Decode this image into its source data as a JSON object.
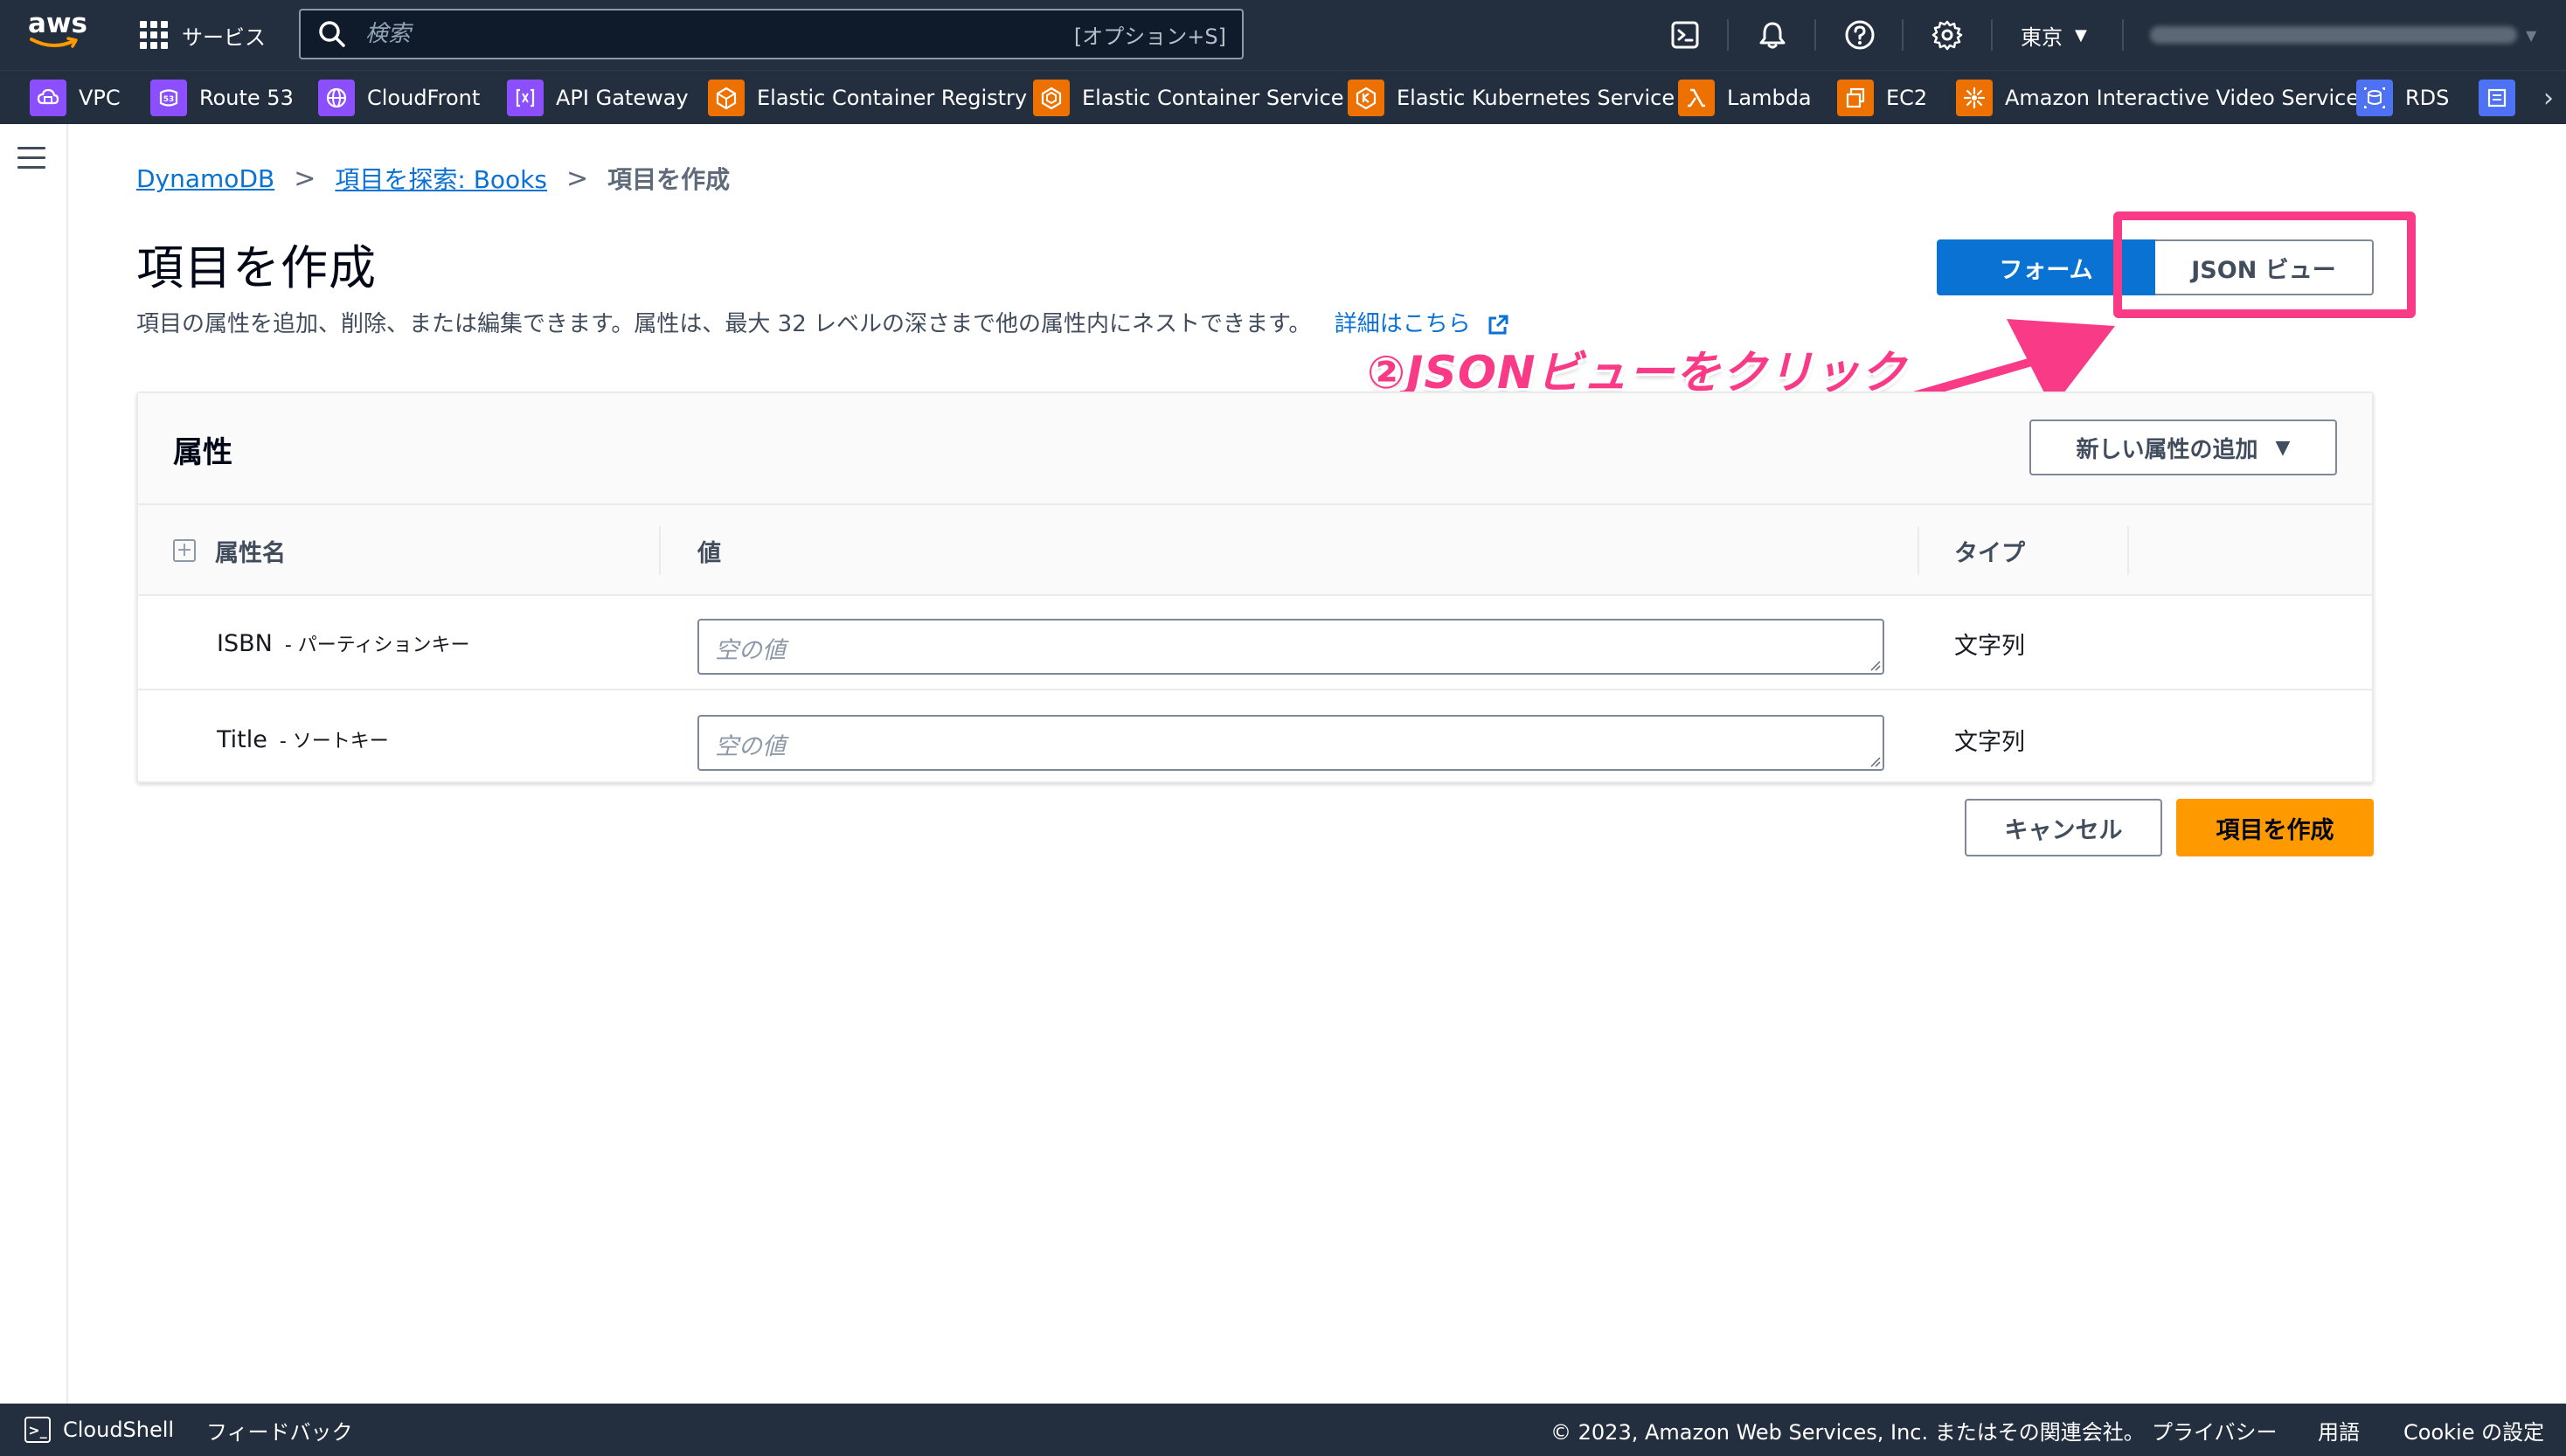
{
  "nav": {
    "logo": "aws",
    "services_label": "サービス",
    "search_placeholder": "検索",
    "search_shortcut": "[オプション+S]",
    "region": "東京"
  },
  "favorites": [
    {
      "label": "VPC",
      "icon": "vpc-icon",
      "color": "#8c4fff"
    },
    {
      "label": "Route 53",
      "icon": "route53-icon",
      "color": "#8c4fff"
    },
    {
      "label": "CloudFront",
      "icon": "cloudfront-icon",
      "color": "#8c4fff"
    },
    {
      "label": "API Gateway",
      "icon": "api-gateway-icon",
      "color": "#8c4fff"
    },
    {
      "label": "Elastic Container Registry",
      "icon": "ecr-icon",
      "color": "#ed7100"
    },
    {
      "label": "Elastic Container Service",
      "icon": "ecs-icon",
      "color": "#ed7100"
    },
    {
      "label": "Elastic Kubernetes Service",
      "icon": "eks-icon",
      "color": "#ed7100"
    },
    {
      "label": "Lambda",
      "icon": "lambda-icon",
      "color": "#ed7100"
    },
    {
      "label": "EC2",
      "icon": "ec2-icon",
      "color": "#ed7100"
    },
    {
      "label": "Amazon Interactive Video Service",
      "icon": "ivs-icon",
      "color": "#ed7100"
    },
    {
      "label": "RDS",
      "icon": "rds-icon",
      "color": "#4d72f3"
    }
  ],
  "breadcrumb": {
    "root": "DynamoDB",
    "parent": "項目を探索: Books",
    "current": "項目を作成"
  },
  "page": {
    "title": "項目を作成",
    "description": "項目の属性を追加、削除、または編集できます。属性は、最大 32 レベルの深さまで他の属性内にネストできます。",
    "learn_more": "詳細はこちら"
  },
  "view_toggle": {
    "form_label": "フォーム",
    "json_label": "JSON ビュー",
    "selected": "フォーム"
  },
  "annotation": {
    "text": "②JSONビューをクリック",
    "color": "#f93a87"
  },
  "attributes": {
    "title": "属性",
    "add_button": "新しい属性の追加",
    "columns": {
      "name": "属性名",
      "value": "値",
      "type": "タイプ"
    },
    "rows": [
      {
        "name": "ISBN",
        "key_label": "- パーティションキー",
        "placeholder": "空の値",
        "type": "文字列"
      },
      {
        "name": "Title",
        "key_label": "- ソートキー",
        "placeholder": "空の値",
        "type": "文字列"
      }
    ]
  },
  "actions": {
    "cancel": "キャンセル",
    "create": "項目を作成"
  },
  "footer": {
    "cloudshell": "CloudShell",
    "feedback": "フィードバック",
    "copyright": "© 2023, Amazon Web Services, Inc. またはその関連会社。",
    "privacy": "プライバシー",
    "terms": "用語",
    "cookie": "Cookie の設定"
  }
}
